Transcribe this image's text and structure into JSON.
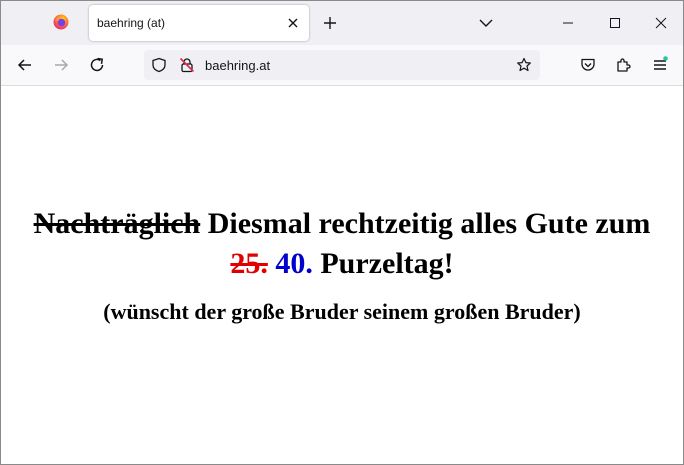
{
  "browser": {
    "tab_title": "baehring (at)",
    "url": "baehring.at",
    "accent_color": "#2ac3a2"
  },
  "page": {
    "headline": {
      "struck_word": "Nachträglich",
      "main_text": "Diesmal rechtzeitig alles Gute zum",
      "old_number": "25.",
      "new_number": "40.",
      "ending": "Purzeltag!"
    },
    "subline": "(wünscht der große Bruder seinem großen Bruder)",
    "colors": {
      "struck_number": "#e00000",
      "new_number": "#0000cc"
    }
  }
}
